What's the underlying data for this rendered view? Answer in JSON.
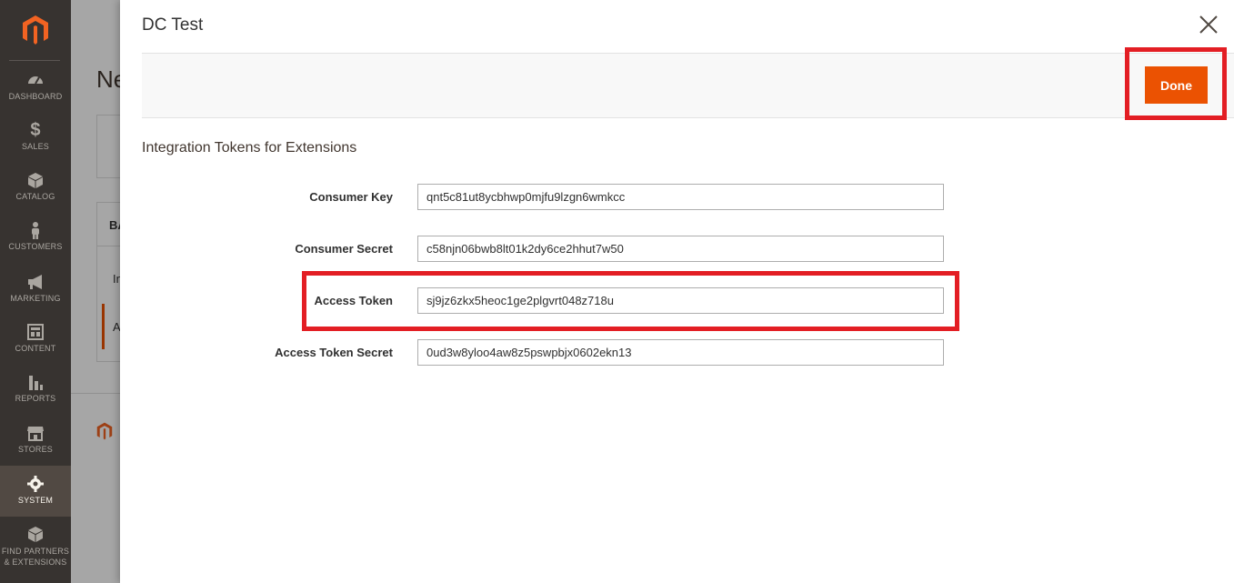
{
  "sidebar": {
    "items": [
      {
        "label": "DASHBOARD",
        "icon": "dashboard-icon"
      },
      {
        "label": "SALES",
        "icon": "dollar-icon"
      },
      {
        "label": "CATALOG",
        "icon": "box-icon"
      },
      {
        "label": "CUSTOMERS",
        "icon": "person-icon"
      },
      {
        "label": "MARKETING",
        "icon": "megaphone-icon"
      },
      {
        "label": "CONTENT",
        "icon": "layout-icon"
      },
      {
        "label": "REPORTS",
        "icon": "bar-chart-icon"
      },
      {
        "label": "STORES",
        "icon": "storefront-icon"
      },
      {
        "label": "SYSTEM",
        "icon": "gear-icon"
      },
      {
        "label_line1": "FIND PARTNERS",
        "label_line2": "& EXTENSIONS",
        "icon": "blocks-icon"
      }
    ]
  },
  "background_page": {
    "title_fragment": "Ne",
    "tab_fragment": "BA",
    "row_fragment_1": "In",
    "row_fragment_2": "A"
  },
  "modal": {
    "title": "DC Test",
    "done_label": "Done",
    "section_title": "Integration Tokens for Extensions",
    "fields": [
      {
        "label": "Consumer Key",
        "value": "qnt5c81ut8ycbhwp0mjfu9lzgn6wmkcc"
      },
      {
        "label": "Consumer Secret",
        "value": "c58njn06bwb8lt01k2dy6ce2hhut7w50"
      },
      {
        "label": "Access Token",
        "value": "sj9jz6zkx5heoc1ge2plgvrt048z718u"
      },
      {
        "label": "Access Token Secret",
        "value": "0ud3w8yloo4aw8z5pswpbjx0602ekn13"
      }
    ]
  },
  "colors": {
    "sidebar_bg": "#373330",
    "accent": "#eb5202",
    "highlight": "#e31e24"
  }
}
